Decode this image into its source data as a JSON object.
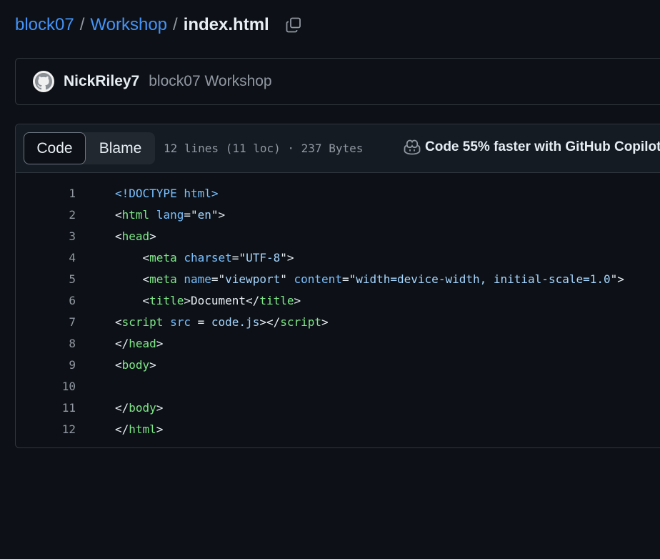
{
  "breadcrumb": {
    "owner": "block07",
    "separator": "/",
    "repo": "Workshop",
    "file": "index.html"
  },
  "commit": {
    "author": "NickRiley7",
    "message": "block07 Workshop"
  },
  "file_header": {
    "tabs": [
      "Code",
      "Blame"
    ],
    "active_tab": "Code",
    "info": "12 lines (11 loc) · 237 Bytes",
    "copilot_label": "Code 55% faster with GitHub Copilot"
  },
  "icons": {
    "copy": "copy-icon",
    "avatar": "github-octocat-icon",
    "copilot": "copilot-icon"
  },
  "colors": {
    "background": "#0d1117",
    "link": "#4493f8",
    "tag": "#7ee787",
    "attribute": "#79c0ff",
    "string": "#a5d6ff",
    "muted": "#9198a1",
    "border": "#30363d"
  },
  "code_lines": [
    {
      "n": "1",
      "tokens": [
        [
          "doctype",
          "<!DOCTYPE html>"
        ]
      ]
    },
    {
      "n": "2",
      "tokens": [
        [
          "punct",
          "<"
        ],
        [
          "tag",
          "html"
        ],
        [
          "plain",
          " "
        ],
        [
          "attr",
          "lang"
        ],
        [
          "punct",
          "="
        ],
        [
          "punct",
          "\""
        ],
        [
          "str",
          "en"
        ],
        [
          "punct",
          "\""
        ],
        [
          "punct",
          ">"
        ]
      ]
    },
    {
      "n": "3",
      "tokens": [
        [
          "punct",
          "<"
        ],
        [
          "tag",
          "head"
        ],
        [
          "punct",
          ">"
        ]
      ]
    },
    {
      "n": "4",
      "tokens": [
        [
          "plain",
          "    "
        ],
        [
          "punct",
          "<"
        ],
        [
          "tag",
          "meta"
        ],
        [
          "plain",
          " "
        ],
        [
          "attr",
          "charset"
        ],
        [
          "punct",
          "="
        ],
        [
          "punct",
          "\""
        ],
        [
          "str",
          "UTF-8"
        ],
        [
          "punct",
          "\""
        ],
        [
          "punct",
          ">"
        ]
      ]
    },
    {
      "n": "5",
      "tokens": [
        [
          "plain",
          "    "
        ],
        [
          "punct",
          "<"
        ],
        [
          "tag",
          "meta"
        ],
        [
          "plain",
          " "
        ],
        [
          "attr",
          "name"
        ],
        [
          "punct",
          "="
        ],
        [
          "punct",
          "\""
        ],
        [
          "str",
          "viewport"
        ],
        [
          "punct",
          "\""
        ],
        [
          "plain",
          " "
        ],
        [
          "attr",
          "content"
        ],
        [
          "punct",
          "="
        ],
        [
          "punct",
          "\""
        ],
        [
          "str",
          "width=device-width, initial-scale=1.0"
        ],
        [
          "punct",
          "\""
        ],
        [
          "punct",
          ">"
        ]
      ]
    },
    {
      "n": "6",
      "tokens": [
        [
          "plain",
          "    "
        ],
        [
          "punct",
          "<"
        ],
        [
          "tag",
          "title"
        ],
        [
          "punct",
          ">"
        ],
        [
          "plain",
          "Document"
        ],
        [
          "punct",
          "</"
        ],
        [
          "tag",
          "title"
        ],
        [
          "punct",
          ">"
        ]
      ]
    },
    {
      "n": "7",
      "tokens": [
        [
          "punct",
          "<"
        ],
        [
          "tag",
          "script"
        ],
        [
          "plain",
          " "
        ],
        [
          "attr",
          "src"
        ],
        [
          "plain",
          " = "
        ],
        [
          "str",
          "code.js"
        ],
        [
          "punct",
          "></"
        ],
        [
          "tag",
          "script"
        ],
        [
          "punct",
          ">"
        ]
      ]
    },
    {
      "n": "8",
      "tokens": [
        [
          "punct",
          "</"
        ],
        [
          "tag",
          "head"
        ],
        [
          "punct",
          ">"
        ]
      ]
    },
    {
      "n": "9",
      "tokens": [
        [
          "punct",
          "<"
        ],
        [
          "tag",
          "body"
        ],
        [
          "punct",
          ">"
        ]
      ]
    },
    {
      "n": "10",
      "tokens": []
    },
    {
      "n": "11",
      "tokens": [
        [
          "punct",
          "</"
        ],
        [
          "tag",
          "body"
        ],
        [
          "punct",
          ">"
        ]
      ]
    },
    {
      "n": "12",
      "tokens": [
        [
          "punct",
          "</"
        ],
        [
          "tag",
          "html"
        ],
        [
          "punct",
          ">"
        ]
      ]
    }
  ]
}
